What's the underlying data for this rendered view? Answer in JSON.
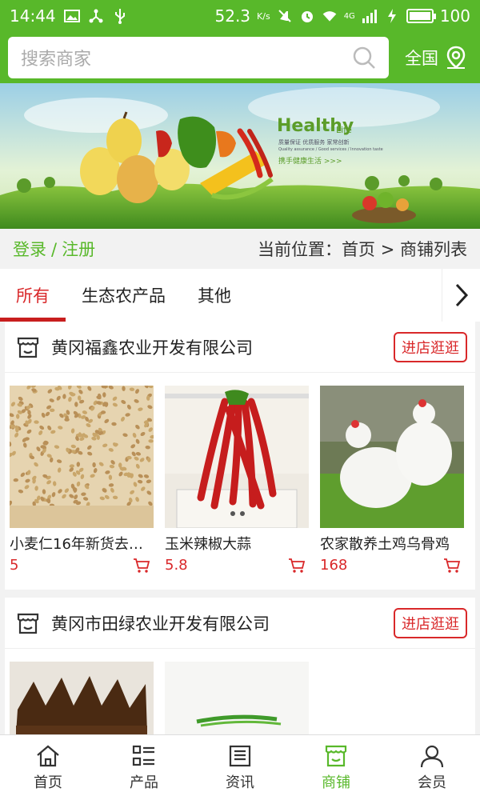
{
  "status_bar": {
    "time": "14:44",
    "speed": "52.3",
    "speed_unit": "K/s",
    "network": "4G",
    "battery": "100",
    "battery_level": 1.0,
    "icons": [
      "image-icon",
      "share-icon",
      "usb-icon",
      "mute-icon",
      "alarm-icon",
      "wifi-icon",
      "signal-icon",
      "charging-icon",
      "battery-icon"
    ]
  },
  "search": {
    "placeholder": "搜索商家",
    "region_label": "全国"
  },
  "banner": {
    "headline": "Healthy",
    "headline_suffix": "Life",
    "line1": "质量保证 优质服务 家常创新",
    "line2": "Quality assurance / Good services / Innovation taste",
    "slogan": "携手健康生活 >>>"
  },
  "crumb_row": {
    "login": "登录",
    "separator": "/",
    "register": "注册",
    "location": "当前位置：首页 > 商铺列表"
  },
  "tabs": [
    {
      "label": "所有",
      "active": true
    },
    {
      "label": "生态农产品",
      "active": false
    },
    {
      "label": "其他",
      "active": false
    }
  ],
  "shops": [
    {
      "name": "黄冈福鑫农业开发有限公司",
      "enter_label": "进店逛逛",
      "products": [
        {
          "name": "小麦仁16年新货去…",
          "price": "5"
        },
        {
          "name": "玉米辣椒大蒜",
          "price": "5.8"
        },
        {
          "name": "农家散养土鸡乌骨鸡",
          "price": "168"
        }
      ]
    },
    {
      "name": "黄冈市田绿农业开发有限公司",
      "enter_label": "进店逛逛",
      "products": [
        {
          "name": "",
          "price": ""
        },
        {
          "name": "",
          "price": ""
        }
      ]
    }
  ],
  "bottom_nav": [
    {
      "label": "首页",
      "icon": "home-icon",
      "active": false
    },
    {
      "label": "产品",
      "icon": "product-grid-icon",
      "active": false
    },
    {
      "label": "资讯",
      "icon": "news-icon",
      "active": false
    },
    {
      "label": "商铺",
      "icon": "shop-icon",
      "active": true
    },
    {
      "label": "会员",
      "icon": "member-icon",
      "active": false
    }
  ],
  "colors": {
    "brand_green": "#58b82a",
    "accent_red": "#d9282a",
    "background": "#f2f2f2"
  }
}
